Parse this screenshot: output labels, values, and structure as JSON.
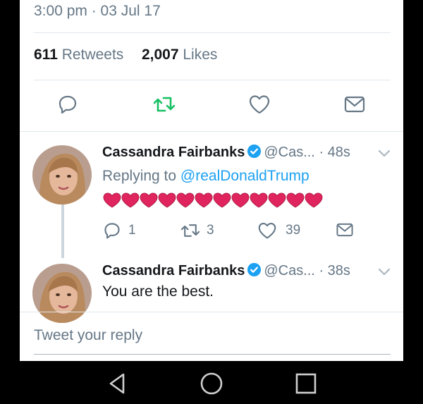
{
  "tweet": {
    "timestamp": "3:00 pm · 03 Jul 17",
    "retweets_count": "611",
    "retweets_label": "Retweets",
    "likes_count": "2,007",
    "likes_label": "Likes"
  },
  "action_icons": [
    "reply-icon",
    "retweet-icon",
    "like-icon",
    "dm-icon"
  ],
  "replies": [
    {
      "name": "Cassandra Fairbanks",
      "handle": "@Cas...",
      "time": "· 48s",
      "replying_prefix": "Replying to",
      "replying_mention": "@realDonaldTrump",
      "hearts_count": 12,
      "reply_count": "1",
      "retweet_count": "3",
      "like_count": "39"
    },
    {
      "name": "Cassandra Fairbanks",
      "handle": "@Cas...",
      "time": "· 38s",
      "text": "You are the best."
    }
  ],
  "composer": {
    "placeholder": "Tweet your reply"
  },
  "nav": [
    "back-icon",
    "home-icon",
    "recents-icon"
  ],
  "colors": {
    "accent": "#1da1f2",
    "retweet_green": "#17bf63",
    "heart_red": "#e0245e",
    "muted": "#657786"
  }
}
